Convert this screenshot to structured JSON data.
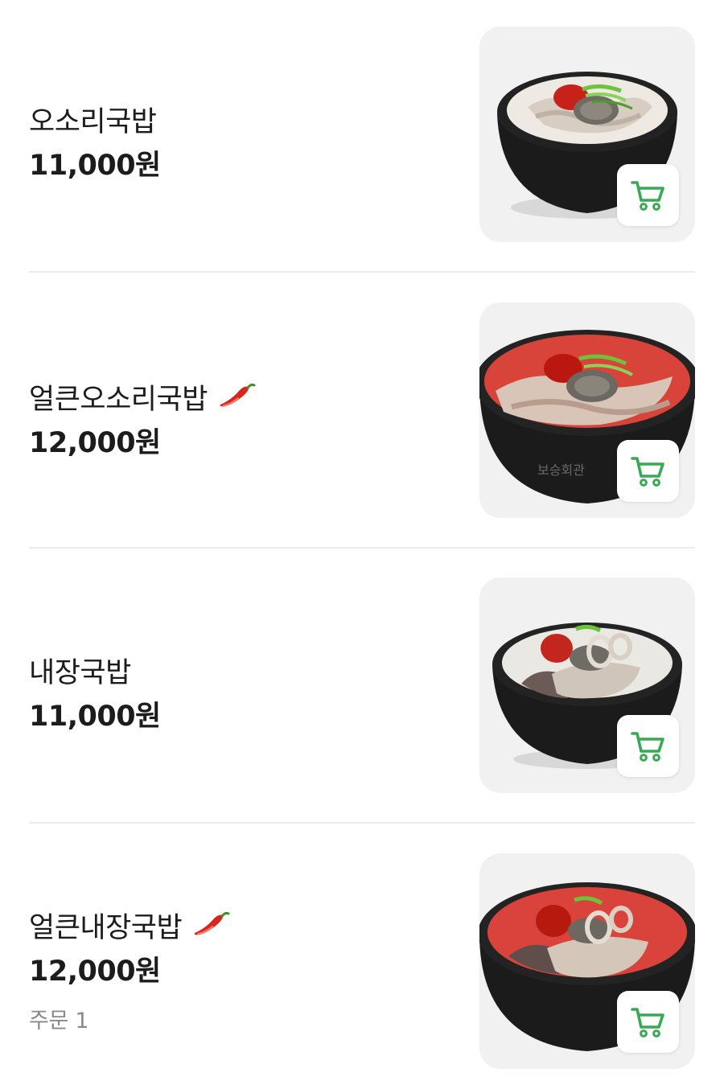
{
  "colors": {
    "cart_green": "#3aa955",
    "divider": "#ececec",
    "thumb_bg": "#f1f1f1",
    "orders_text": "#8a8a8a"
  },
  "menu": {
    "items": [
      {
        "name": "오소리국밥",
        "price": "11,000원",
        "spicy": false,
        "broth": "white",
        "icon": "cart-icon"
      },
      {
        "name": "얼큰오소리국밥",
        "price": "12,000원",
        "spicy": true,
        "spicy_icon": "chili-pepper-icon",
        "broth": "red",
        "bowl_text": "보승회관",
        "icon": "cart-icon"
      },
      {
        "name": "내장국밥",
        "price": "11,000원",
        "spicy": false,
        "broth": "white",
        "icon": "cart-icon"
      },
      {
        "name": "얼큰내장국밥",
        "price": "12,000원",
        "spicy": true,
        "spicy_icon": "chili-pepper-icon",
        "broth": "red",
        "orders": "주문 1",
        "icon": "cart-icon"
      }
    ]
  }
}
